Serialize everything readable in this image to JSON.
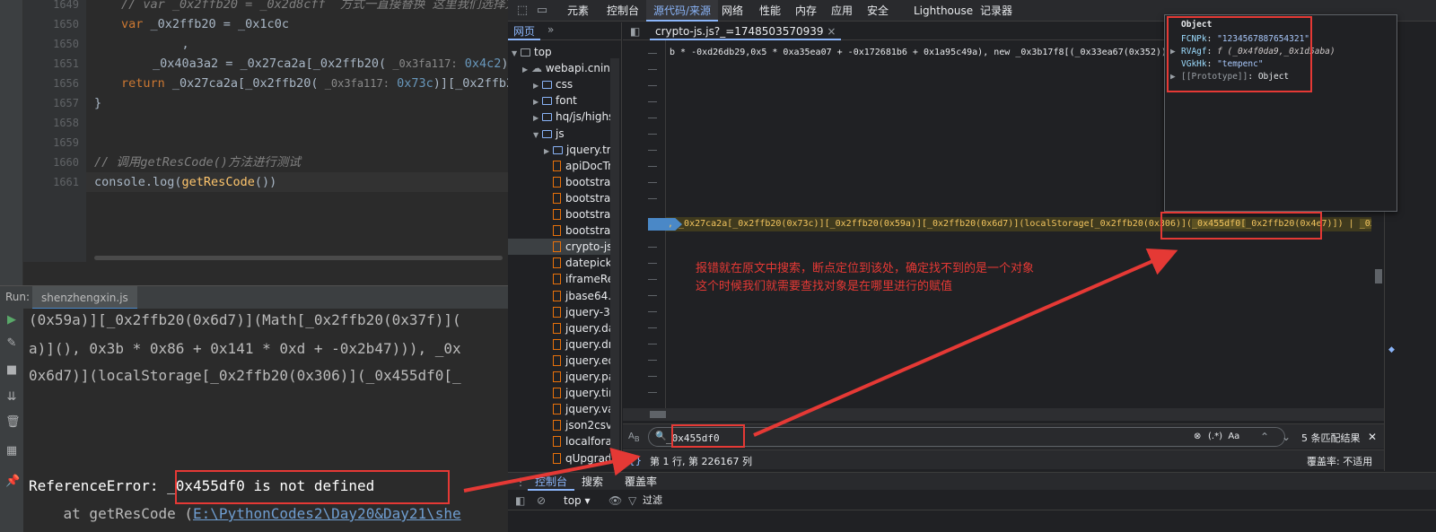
{
  "ide": {
    "code_lines": [
      {
        "num": "1649",
        "comment_prefix": "// var _0x2ffb20 = _0x2d8cff",
        "comment_rest": "  方式一直接替换 这里我们选择方式"
      },
      {
        "num": "1650",
        "keyword": "var",
        "text": " _0x2ffb20 = _0x1c0c"
      },
      {
        "num": "1650",
        "text": ",",
        "pad": "    "
      },
      {
        "num": "1651",
        "pre": "_0x40a3a2 = _0x27ca2a[_0x2ffb20(",
        "hint": " _0x3fa117:",
        "val": " 0x4c2",
        "post": ")][_0x"
      },
      {
        "num": "1656",
        "keyword": "return",
        "pre": " _0x27ca2a[_0x2ffb20(",
        "hint": " _0x3fa117:",
        "val": " 0x73c",
        "post": ")][_0x2ffb20("
      },
      {
        "num": "1657",
        "text": "}"
      },
      {
        "num": "1658",
        "text": ""
      },
      {
        "num": "1659",
        "text": ""
      },
      {
        "num": "1660",
        "comment_a": "// 调用",
        "comment_b": "getResCode()",
        "comment_c": "方法进行测试"
      },
      {
        "num": "1661",
        "pre": "console.log(",
        "fn": "getResCode",
        "post": "())"
      }
    ],
    "run_label": "Run:",
    "run_tab": "shenzhengxin.js",
    "console_lines": [
      "(0x59a)][_0x2ffb20(0x6d7)](Math[_0x2ffb20(0x37f)](",
      "a)](), 0x3b * 0x86 + 0x141 * 0xd + -0x2b47))), _0x",
      "0x6d7)](localStorage[_0x2ffb20(0x306)](_0x455df0[_"
    ],
    "error_prefix": "ReferenceError: ",
    "error_msg": "_0x455df0 is not defined",
    "stack_prefix": "    at getResCode (",
    "stack_path": "E:\\PythonCodes2\\Day20&Day21\\she"
  },
  "devtools": {
    "tabs": [
      "元素",
      "控制台",
      "源代码/来源",
      "网络",
      "性能",
      "内存",
      "应用",
      "安全",
      "Lighthouse",
      "记录器"
    ],
    "active_tab": "源代码/来源",
    "sidebar_tab": "网页",
    "sidebar_more": "»",
    "tree": [
      {
        "label": "top",
        "kind": "frame",
        "indent": 0
      },
      {
        "label": "webapi.cninfo",
        "kind": "cloud",
        "indent": 1
      },
      {
        "label": "css",
        "kind": "folder",
        "indent": 2
      },
      {
        "label": "font",
        "kind": "folder",
        "indent": 2
      },
      {
        "label": "hq/js/highs",
        "kind": "folder",
        "indent": 2
      },
      {
        "label": "js",
        "kind": "folder-open",
        "indent": 2
      },
      {
        "label": "jquery.tre",
        "kind": "folder",
        "indent": 3
      },
      {
        "label": "apiDocTr",
        "kind": "file",
        "indent": 3
      },
      {
        "label": "bootstrap",
        "kind": "file",
        "indent": 3
      },
      {
        "label": "bootstrap",
        "kind": "file",
        "indent": 3
      },
      {
        "label": "bootstrap",
        "kind": "file",
        "indent": 3
      },
      {
        "label": "bootstrap",
        "kind": "file",
        "indent": 3
      },
      {
        "label": "crypto-js",
        "kind": "file",
        "indent": 3,
        "selected": true
      },
      {
        "label": "datepick",
        "kind": "file",
        "indent": 3
      },
      {
        "label": "iframeRe",
        "kind": "file",
        "indent": 3
      },
      {
        "label": "jbase64.j",
        "kind": "file",
        "indent": 3
      },
      {
        "label": "jquery-3",
        "kind": "file",
        "indent": 3
      },
      {
        "label": "jquery.da",
        "kind": "file",
        "indent": 3
      },
      {
        "label": "jquery.dr",
        "kind": "file",
        "indent": 3
      },
      {
        "label": "jquery.ed",
        "kind": "file",
        "indent": 3
      },
      {
        "label": "jquery.pa",
        "kind": "file",
        "indent": 3
      },
      {
        "label": "jquery.tir",
        "kind": "file",
        "indent": 3
      },
      {
        "label": "jquery.va",
        "kind": "file",
        "indent": 3
      },
      {
        "label": "json2csv.",
        "kind": "file",
        "indent": 3
      },
      {
        "label": "localfora",
        "kind": "file",
        "indent": 3
      },
      {
        "label": "qUpgrad",
        "kind": "file",
        "indent": 3
      }
    ],
    "editor_tab": "crypto-js.js?_=1748503570939",
    "top_code": "b * -0xd26db29,0x5 * 0xa35ea07 + -0x172681b6 + 0x1a95c49a), new _0x3b17f8[(_0x33ea67(0x352))](0x3b94827e",
    "exec_code_a": ", _0x27ca2a[",
    "exec_code_b": "_0x2ffb20(0x73c)][",
    "exec_code_c": "_0x2ffb20(0x59a)][",
    "exec_code_d": "_0x2ffb20(0x6d7)](",
    "exec_code_e": "localStorage[",
    "exec_code_f": "_0x2ffb20(0x306)](",
    "exec_code_g": "_0x455df0[",
    "exec_code_h": "_0x2ffb20(0x4e7)])",
    "exec_code_i": " | ",
    "exec_code_j": "_0x455df0",
    "search_value": "_0x455df0",
    "search_opts": "(.*)  Aa",
    "match_count": "5 条匹配结果",
    "position": "第 1 行, 第 226167 列",
    "coverage": "覆盖率: 不适用",
    "drawer_tabs": [
      "控制台",
      "搜索",
      "覆盖率"
    ],
    "drawer_context": "top ▾",
    "drawer_filter": "过滤"
  },
  "popover": {
    "title": "Object",
    "entries": [
      {
        "key": "FCNPk",
        "value": "\"1234567887654321\"",
        "type": "string"
      },
      {
        "key": "RVAgf",
        "value": "f (_0x4f0da9,_0x1d5aba)",
        "type": "func",
        "arrow": "▶"
      },
      {
        "key": "VGkHk",
        "value": "\"tempenc\"",
        "type": "string"
      },
      {
        "key": "[[Prototype]]",
        "value": "Object",
        "type": "proto",
        "arrow": "▶"
      }
    ]
  },
  "annotation": {
    "line1": "报错就在原文中搜索，断点定位到该处，确定找不到的是一个对象",
    "line2": "这个时候我们就需要查找对象是在哪里进行的赋值"
  },
  "colors": {
    "annotation": "#e53935",
    "accent": "#8ab4f8"
  }
}
